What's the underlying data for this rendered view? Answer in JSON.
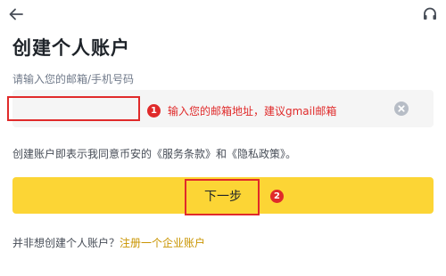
{
  "header": {
    "back_icon": "arrow-left-icon",
    "support_icon": "headset-icon"
  },
  "page_title": "创建个人账户",
  "email_field": {
    "label": "请输入您的邮箱/手机号码",
    "value": "",
    "clear_icon": "clear-circle-icon"
  },
  "annotations": {
    "step1_number": "1",
    "step1_text": "输入您的邮箱地址，建议gmail邮箱",
    "step2_number": "2",
    "color": "#e02a2a"
  },
  "terms": {
    "prefix": "创建账户即表示我同意币安的",
    "service_terms": "《服务条款》",
    "conjunction": "和",
    "privacy_policy": "《隐私政策》",
    "suffix": "。"
  },
  "next_button_label": "下一步",
  "footer": {
    "question": "并非想创建个人账户？",
    "link_label": "注册一个企业账户"
  },
  "colors": {
    "accent": "#fcd535",
    "link": "#c99400",
    "text_primary": "#1e2329",
    "text_secondary": "#707a8a"
  }
}
